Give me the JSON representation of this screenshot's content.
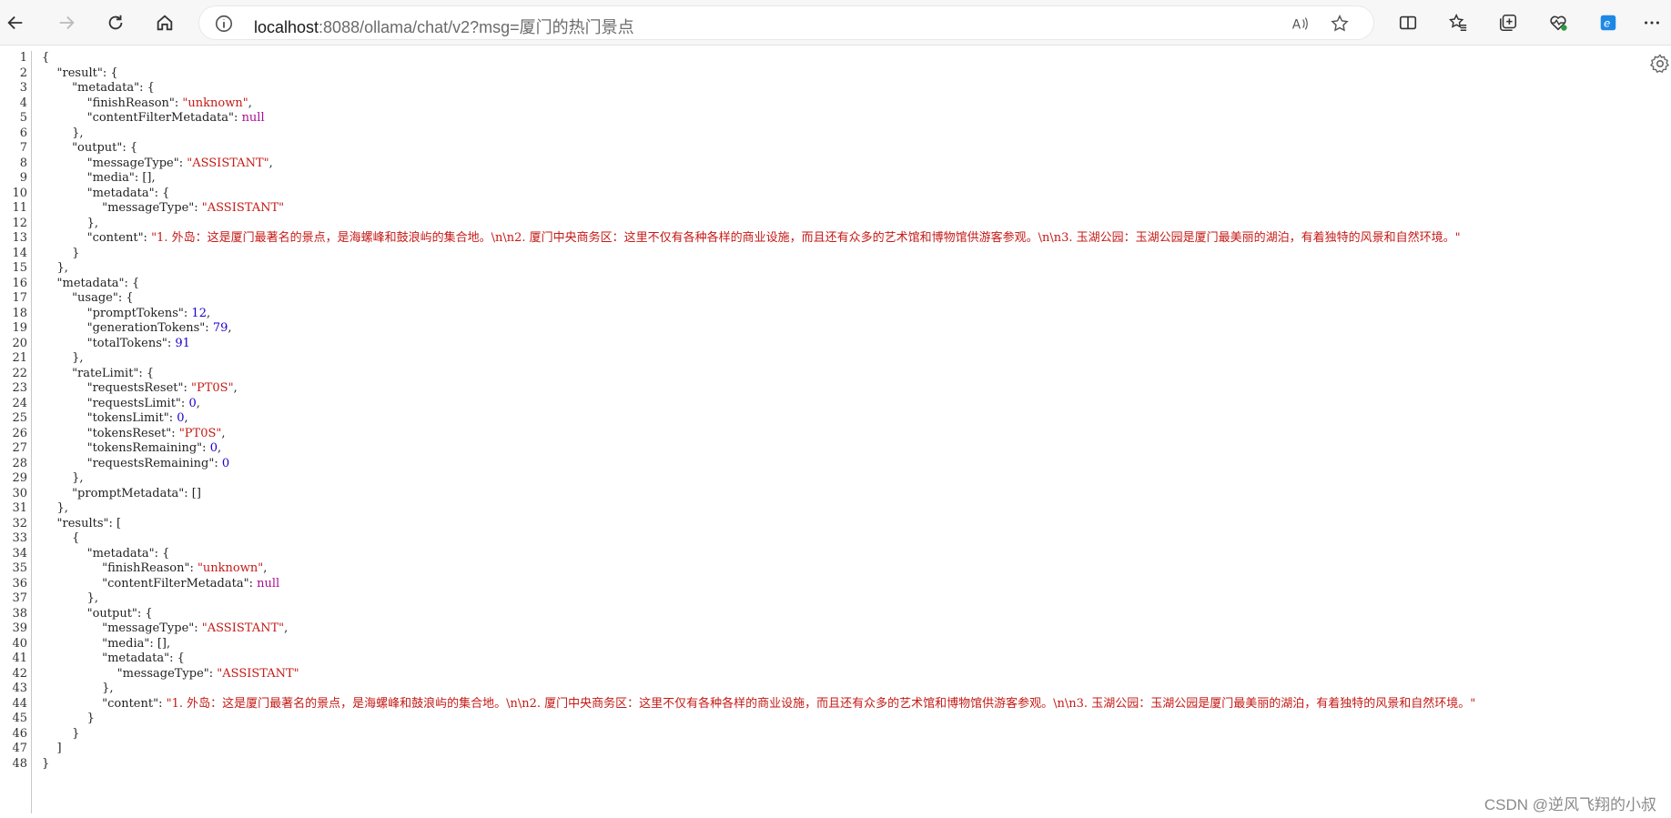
{
  "browser": {
    "url_host": "localhost",
    "url_rest": ":8088/ollama/chat/v2?msg=厦门的热门景点",
    "icons": [
      "back-icon",
      "forward-icon",
      "refresh-icon",
      "home-icon",
      "info-icon",
      "read-aloud-icon",
      "favorite-star-icon",
      "split-screen-icon",
      "favorites-icon",
      "collections-icon",
      "health-icon",
      "edge-e-icon",
      "more-icon"
    ]
  },
  "json_viewer": {
    "line_numbers": [
      "1",
      "2",
      "3",
      "4",
      "5",
      "6",
      "7",
      "8",
      "9",
      "10",
      "11",
      "12",
      "13",
      "14",
      "15",
      "16",
      "17",
      "18",
      "19",
      "20",
      "21",
      "22",
      "23",
      "24",
      "25",
      "26",
      "27",
      "28",
      "29",
      "30",
      "31",
      "32",
      "33",
      "34",
      "35",
      "36",
      "37",
      "38",
      "39",
      "40",
      "41",
      "42",
      "43",
      "44",
      "45",
      "46",
      "47",
      "48"
    ],
    "lines": [
      {
        "ind": 0,
        "t": "{"
      },
      {
        "ind": 1,
        "k": "result",
        "t": ": {"
      },
      {
        "ind": 2,
        "k": "metadata",
        "t": ": {"
      },
      {
        "ind": 3,
        "k": "finishReason",
        "s": "\"unknown\"",
        "t": ","
      },
      {
        "ind": 3,
        "k": "contentFilterMetadata",
        "n": "null",
        "t": ""
      },
      {
        "ind": 2,
        "t": "},"
      },
      {
        "ind": 2,
        "k": "output",
        "t": ": {"
      },
      {
        "ind": 3,
        "k": "messageType",
        "s": "\"ASSISTANT\"",
        "t": ","
      },
      {
        "ind": 3,
        "k": "media",
        "t": ": [],"
      },
      {
        "ind": 3,
        "k": "metadata",
        "t": ": {"
      },
      {
        "ind": 4,
        "k": "messageType",
        "s": "\"ASSISTANT\"",
        "t": ""
      },
      {
        "ind": 3,
        "t": "},"
      },
      {
        "ind": 3,
        "k": "content",
        "s": "\"1. 外岛：这是厦门最著名的景点，是海螺峰和鼓浪屿的集合地。\\n\\n2. 厦门中央商务区：这里不仅有各种各样的商业设施，而且还有众多的艺术馆和博物馆供游客参观。\\n\\n3. 玉湖公园：玉湖公园是厦门最美丽的湖泊，有着独特的风景和自然环境。\"",
        "t": "",
        "wrap": true
      },
      {
        "ind": 2,
        "t": "}"
      },
      {
        "ind": 1,
        "t": "},"
      },
      {
        "ind": 1,
        "k": "metadata",
        "t": ": {"
      },
      {
        "ind": 2,
        "k": "usage",
        "t": ": {"
      },
      {
        "ind": 3,
        "k": "promptTokens",
        "num": "12",
        "t": ","
      },
      {
        "ind": 3,
        "k": "generationTokens",
        "num": "79",
        "t": ","
      },
      {
        "ind": 3,
        "k": "totalTokens",
        "num": "91",
        "t": ""
      },
      {
        "ind": 2,
        "t": "},"
      },
      {
        "ind": 2,
        "k": "rateLimit",
        "t": ": {"
      },
      {
        "ind": 3,
        "k": "requestsReset",
        "s": "\"PT0S\"",
        "t": ","
      },
      {
        "ind": 3,
        "k": "requestsLimit",
        "num": "0",
        "t": ","
      },
      {
        "ind": 3,
        "k": "tokensLimit",
        "num": "0",
        "t": ","
      },
      {
        "ind": 3,
        "k": "tokensReset",
        "s": "\"PT0S\"",
        "t": ","
      },
      {
        "ind": 3,
        "k": "tokensRemaining",
        "num": "0",
        "t": ","
      },
      {
        "ind": 3,
        "k": "requestsRemaining",
        "num": "0",
        "t": ""
      },
      {
        "ind": 2,
        "t": "},"
      },
      {
        "ind": 2,
        "k": "promptMetadata",
        "t": ": []"
      },
      {
        "ind": 1,
        "t": "},"
      },
      {
        "ind": 1,
        "k": "results",
        "t": ": ["
      },
      {
        "ind": 2,
        "t": "{"
      },
      {
        "ind": 3,
        "k": "metadata",
        "t": ": {"
      },
      {
        "ind": 4,
        "k": "finishReason",
        "s": "\"unknown\"",
        "t": ","
      },
      {
        "ind": 4,
        "k": "contentFilterMetadata",
        "n": "null",
        "t": ""
      },
      {
        "ind": 3,
        "t": "},"
      },
      {
        "ind": 3,
        "k": "output",
        "t": ": {"
      },
      {
        "ind": 4,
        "k": "messageType",
        "s": "\"ASSISTANT\"",
        "t": ","
      },
      {
        "ind": 4,
        "k": "media",
        "t": ": [],"
      },
      {
        "ind": 4,
        "k": "metadata",
        "t": ": {"
      },
      {
        "ind": 5,
        "k": "messageType",
        "s": "\"ASSISTANT\"",
        "t": ""
      },
      {
        "ind": 4,
        "t": "},"
      },
      {
        "ind": 4,
        "k": "content",
        "s": "\"1. 外岛：这是厦门最著名的景点，是海螺峰和鼓浪屿的集合地。\\n\\n2. 厦门中央商务区：这里不仅有各种各样的商业设施，而且还有众多的艺术馆和博物馆供游客参观。\\n\\n3. 玉湖公园：玉湖公园是厦门最美丽的湖泊，有着独特的风景和自然环境。\"",
        "t": "",
        "wrap": true
      },
      {
        "ind": 3,
        "t": "}"
      },
      {
        "ind": 2,
        "t": "}"
      },
      {
        "ind": 1,
        "t": "]"
      },
      {
        "ind": 0,
        "t": "}"
      }
    ]
  },
  "watermark": "CSDN @逆风飞翔的小叔"
}
